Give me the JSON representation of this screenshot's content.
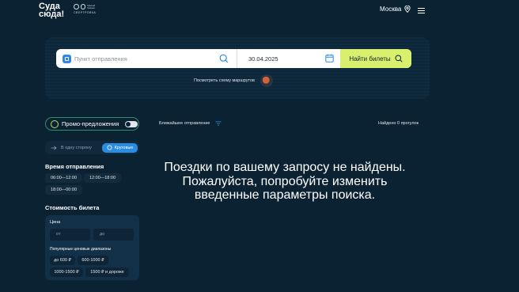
{
  "header": {
    "logo_line1": "Суда",
    "logo_line2": "сюда!",
    "partner_line1": "Малый бизнес",
    "partner_line2": "СВЕРТРОВКА",
    "city": "Москва"
  },
  "search": {
    "from_placeholder": "Пункт отправления",
    "date": "30.04.2025",
    "find_label": "Найти билеты",
    "route_map_link": "Посмотреть схему маршрутов"
  },
  "filters": {
    "promo_label": "Промо-предложения",
    "promo_enabled": false,
    "one_way_label": "В одну сторону",
    "round_trip_label": "Круговые",
    "departure_title": "Время отправления",
    "time_slots": [
      "06:00—12:00",
      "12:00—18:00",
      "18:00—00:00"
    ],
    "price_title": "Стоимость билета",
    "price_label": "Цена",
    "price_from_placeholder": "от",
    "price_to_placeholder": "до",
    "popular_label": "Популярные ценовые диапазоны",
    "price_ranges": [
      "до 600 ₽",
      "600-1000 ₽",
      "1000-1500 ₽",
      "1500 ₽ и дороже"
    ]
  },
  "results": {
    "sort_label": "Ближайшее отправление",
    "found_count": "Найдено 0 прогулок",
    "empty_message": "Поездки по вашему запросу не найдены. Пожалуйста, попробуйте изменить введенные параметры поиска."
  },
  "colors": {
    "background": "#0b2233",
    "accent_button": "#d8f06d",
    "round_trip_active": "#2a8de4",
    "promo_border": "#3b8a6a"
  }
}
